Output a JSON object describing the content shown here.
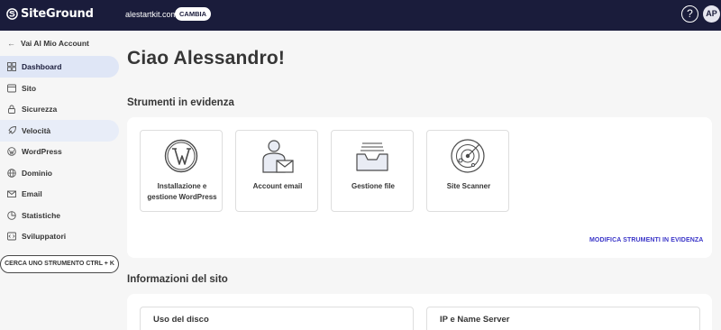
{
  "topbar": {
    "logo_text": "SiteGround",
    "domain": "alestartkit.com",
    "change_label": "CAMBIA",
    "help_label": "?",
    "avatar_initials": "AP"
  },
  "sidebar": {
    "back_label": "Vai Al Mio Account",
    "items": [
      {
        "label": "Dashboard",
        "icon": "grid-icon"
      },
      {
        "label": "Sito",
        "icon": "site-icon"
      },
      {
        "label": "Sicurezza",
        "icon": "lock-icon"
      },
      {
        "label": "Velocità",
        "icon": "rocket-icon"
      },
      {
        "label": "WordPress",
        "icon": "wordpress-icon"
      },
      {
        "label": "Dominio",
        "icon": "globe-icon"
      },
      {
        "label": "Email",
        "icon": "mail-icon"
      },
      {
        "label": "Statistiche",
        "icon": "chart-icon"
      },
      {
        "label": "Sviluppatori",
        "icon": "code-icon"
      }
    ],
    "search_tool_label": "CERCA UNO STRUMENTO CTRL + K"
  },
  "main": {
    "greeting": "Ciao Alessandro!",
    "featured_title": "Strumenti in evidenza",
    "tools": [
      {
        "label": "Installazione e gestione WordPress",
        "icon": "wordpress-logo-icon"
      },
      {
        "label": "Account email",
        "icon": "user-mail-icon"
      },
      {
        "label": "Gestione file",
        "icon": "file-tray-icon"
      },
      {
        "label": "Site Scanner",
        "icon": "radar-icon"
      }
    ],
    "edit_tools_label": "MODIFICA STRUMENTI IN EVIDENZA",
    "info_title": "Informazioni del sito",
    "info_cards": [
      {
        "label": "Uso del disco"
      },
      {
        "label": "IP e Name Server"
      }
    ]
  },
  "colors": {
    "topbar": "#1a1c3b",
    "accent_link": "#3b36c8",
    "active_nav": "#dfe6f6"
  }
}
